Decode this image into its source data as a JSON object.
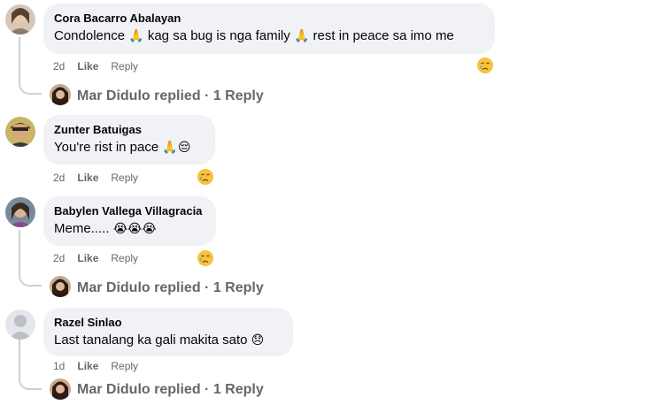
{
  "comments": [
    {
      "author": "Cora Bacarro Abalayan",
      "parts": [
        "Condolence ",
        " kag sa bug is nga family ",
        " rest in peace sa imo me"
      ],
      "emojis": [
        "🙏",
        "🙏"
      ],
      "time": "2d",
      "like": "Like",
      "reply": "Reply",
      "reaction_icon": "crying-face-icon",
      "replies": {
        "name": "Mar Didulo",
        "replied": "replied",
        "dot": "·",
        "count": "1 Reply"
      }
    },
    {
      "author": "Zunter Batuigas",
      "parts": [
        "You're rist in pace "
      ],
      "emojis": [
        "🙏",
        "😔"
      ],
      "time": "2d",
      "like": "Like",
      "reply": "Reply",
      "reaction_icon": "crying-face-icon"
    },
    {
      "author": "Babylen Vallega Villagracia",
      "parts": [
        "Meme..... "
      ],
      "emojis": [
        "😭",
        "😭",
        "😭"
      ],
      "time": "2d",
      "like": "Like",
      "reply": "Reply",
      "reaction_icon": "crying-face-icon",
      "replies": {
        "name": "Mar Didulo",
        "replied": "replied",
        "dot": "·",
        "count": "1 Reply"
      }
    },
    {
      "author": "Razel Sinlao",
      "parts": [
        "Last tanalang ka gali makita sato "
      ],
      "emojis": [
        "😞"
      ],
      "time": "1d",
      "like": "Like",
      "reply": "Reply",
      "replies": {
        "name": "Mar Didulo",
        "replied": "replied",
        "dot": "·",
        "count": "1 Reply"
      }
    }
  ],
  "colors": {
    "bubble": "#f0f2f5",
    "muted": "#65676b",
    "thread_line": "#ced0d4",
    "emoji_yellow": "#f7c23c"
  }
}
